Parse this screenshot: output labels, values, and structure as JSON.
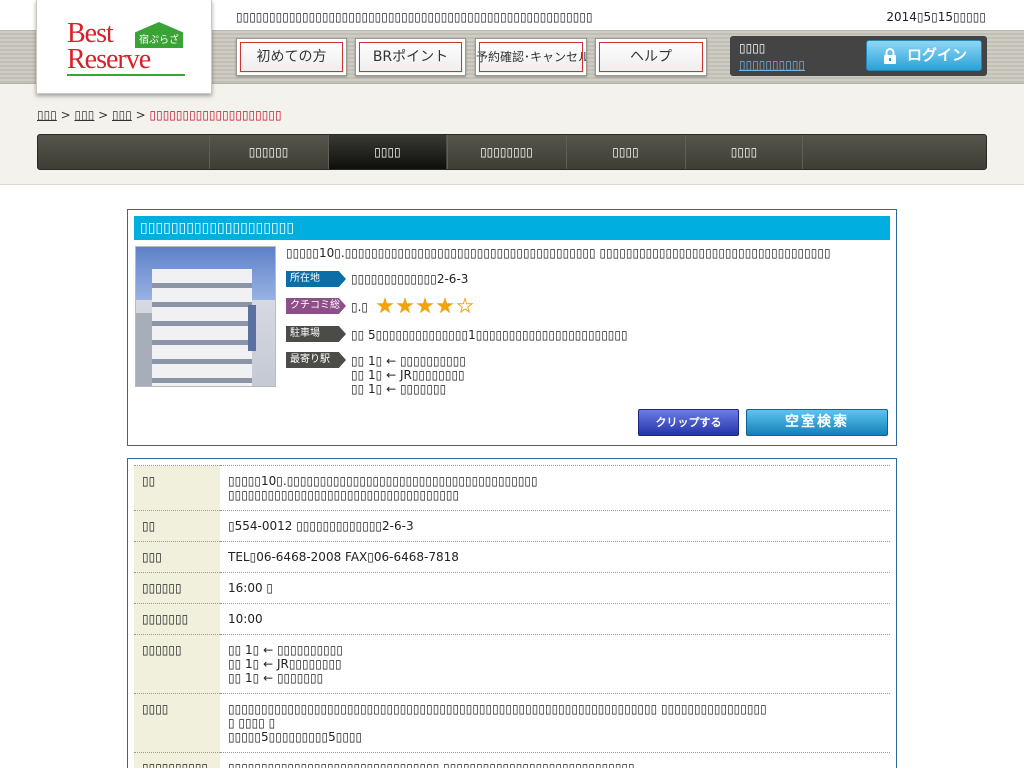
{
  "header": {
    "tagline": "▯▯▯▯▯▯▯▯▯▯▯▯▯▯▯▯▯▯▯▯▯▯▯▯▯▯▯▯▯▯▯▯▯▯▯▯▯▯▯▯▯▯▯▯▯▯▯▯▯▯▯▯▯▯",
    "date": "2014▯5▯15▯▯▯▯▯",
    "logo": {
      "best": "Best",
      "reserve": "Reserve",
      "badge": "宿ぷらざ"
    },
    "nav": [
      {
        "label": "初めての方"
      },
      {
        "label": "BRポイント"
      },
      {
        "label": "予約確認･キャンセル"
      },
      {
        "label": "ヘルプ"
      }
    ],
    "login": {
      "line1": "▯▯▯▯",
      "line2": "▯▯▯▯▯▯▯▯▯▯",
      "button": "ログイン"
    }
  },
  "breadcrumb": [
    {
      "label": "▯▯▯"
    },
    {
      "label": "▯▯▯"
    },
    {
      "label": "▯▯▯"
    },
    {
      "label": "▯▯▯▯▯▯▯▯▯▯▯▯▯▯▯▯▯▯▯▯"
    }
  ],
  "tabs": [
    {
      "label": "▯▯▯▯▯▯"
    },
    {
      "label": "▯▯▯▯"
    },
    {
      "label": "▯▯▯▯▯▯▯▯"
    },
    {
      "label": "▯▯▯▯"
    },
    {
      "label": "▯▯▯▯"
    }
  ],
  "hotel": {
    "name": "▯▯▯▯▯▯▯▯▯▯▯▯▯▯▯▯▯▯▯▯",
    "description": "▯▯▯▯▯10▯.▯▯▯▯▯▯▯▯▯▯▯▯▯▯▯▯▯▯▯▯▯▯▯▯▯▯▯▯▯▯▯▯▯▯▯▯▯▯ ▯▯▯▯▯▯▯▯▯▯▯▯▯▯▯▯▯▯▯▯▯▯▯▯▯▯▯▯▯▯▯▯▯▯▯",
    "labels": {
      "address": "所在地",
      "rating": "クチコミ総合",
      "parking": "駐車場",
      "station": "最寄り駅"
    },
    "address": "▯▯▯▯▯▯▯▯▯▯▯▯▯2-6-3",
    "rating_text": "▯.▯",
    "rating": {
      "stars": 4,
      "out_of": 5
    },
    "parking": "▯▯  5▯▯▯▯▯▯▯▯▯▯▯▯▯▯1▯▯▯▯▯▯▯▯▯▯▯▯▯▯▯▯▯▯▯▯▯▯▯",
    "stations": [
      "▯▯ 1▯ ← ▯▯▯▯▯▯▯▯▯▯",
      "▯▯ 1▯ ← JR▯▯▯▯▯▯▯▯",
      "▯▯ 1▯ ← ▯▯▯▯▯▯▯"
    ],
    "clip_button": "クリップする",
    "search_button": "空室検索"
  },
  "details": [
    {
      "key": "▯▯",
      "lines": [
        "▯▯▯▯▯10▯.▯▯▯▯▯▯▯▯▯▯▯▯▯▯▯▯▯▯▯▯▯▯▯▯▯▯▯▯▯▯▯▯▯▯▯▯▯▯",
        "▯▯▯▯▯▯▯▯▯▯▯▯▯▯▯▯▯▯▯▯▯▯▯▯▯▯▯▯▯▯▯▯▯▯▯"
      ]
    },
    {
      "key": "▯▯",
      "lines": [
        "▯554-0012 ▯▯▯▯▯▯▯▯▯▯▯▯▯2-6-3"
      ]
    },
    {
      "key": "▯▯▯",
      "lines": [
        "TEL▯06-6468-2008 FAX▯06-6468-7818"
      ]
    },
    {
      "key": "▯▯▯▯▯▯",
      "lines": [
        "16:00 ▯"
      ]
    },
    {
      "key": "▯▯▯▯▯▯▯",
      "lines": [
        "10:00"
      ]
    },
    {
      "key": "▯▯▯▯▯▯",
      "lines": [
        "▯▯ 1▯ ← ▯▯▯▯▯▯▯▯▯▯",
        "▯▯ 1▯ ← JR▯▯▯▯▯▯▯▯",
        "▯▯ 1▯ ← ▯▯▯▯▯▯▯"
      ]
    },
    {
      "key": "▯▯▯▯",
      "lines": [
        "▯▯▯▯▯▯▯▯▯▯▯▯▯▯▯▯▯▯▯▯▯▯▯▯▯▯▯▯▯▯▯▯▯▯▯▯▯▯▯▯▯▯▯▯▯▯▯▯▯▯▯▯▯▯▯▯▯▯▯▯▯▯▯▯▯ ▯▯▯▯▯▯▯▯▯▯▯▯▯▯▯▯",
        "▯ ▯▯▯▯ ▯",
        "▯▯▯▯▯5▯▯▯▯▯▯▯▯▯5▯▯▯▯"
      ]
    },
    {
      "key": "▯▯▯▯▯▯▯▯▯▯",
      "lines": [
        "▯▯▯▯▯▯▯▯▯▯▯▯▯▯▯▯▯▯▯▯▯▯▯▯▯▯▯▯▯▯▯▯ ▯▯▯▯▯▯▯▯▯▯▯▯▯▯▯▯▯▯▯▯▯▯▯▯▯▯▯▯▯"
      ]
    }
  ],
  "colors": {
    "accent": "#00aee0",
    "brand_red": "#d8202a",
    "brand_green": "#3aa335",
    "tab_bar": "#3e3e35"
  }
}
